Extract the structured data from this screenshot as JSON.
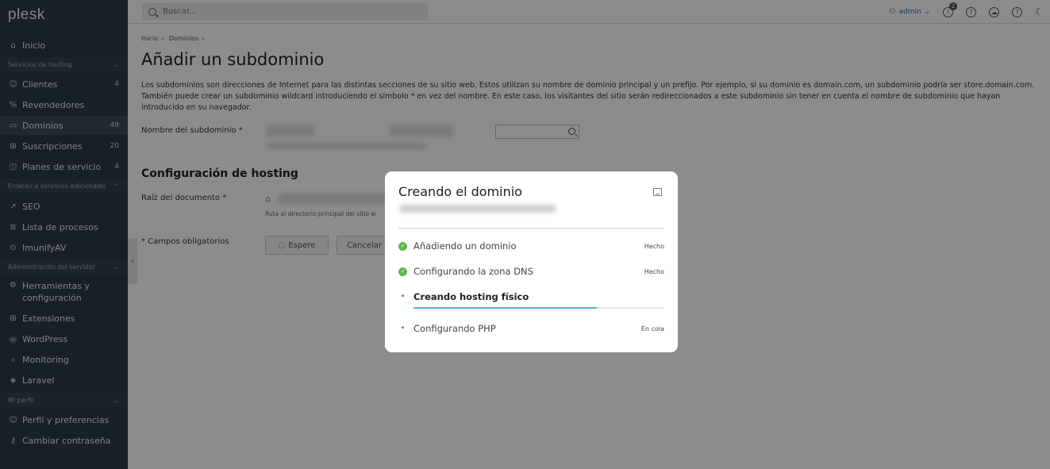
{
  "app": {
    "logo": "plesk"
  },
  "search": {
    "placeholder": "Buscar..."
  },
  "topbar": {
    "user": "admin",
    "notifications_count": "2"
  },
  "sidebar": {
    "items": [
      {
        "label": "Inicio",
        "icon": "home-icon"
      },
      {
        "label": "Clientes",
        "count": "4",
        "icon": "user-icon"
      },
      {
        "label": "Revendedores",
        "icon": "percent-icon"
      },
      {
        "label": "Dominios",
        "count": "49",
        "icon": "monitor-icon"
      },
      {
        "label": "Suscripciones",
        "count": "20",
        "icon": "grid-icon"
      },
      {
        "label": "Planes de servicio",
        "count": "4",
        "icon": "plan-icon"
      },
      {
        "label": "SEO",
        "icon": "seo-icon"
      },
      {
        "label": "Lista de procesos",
        "icon": "list-icon"
      },
      {
        "label": "ImunifyAV",
        "icon": "shield-icon"
      },
      {
        "label": "Herramientas y configuración",
        "icon": "tools-icon"
      },
      {
        "label": "Extensiones",
        "icon": "puzzle-icon"
      },
      {
        "label": "WordPress",
        "icon": "wordpress-icon"
      },
      {
        "label": "Monitoring",
        "icon": "monitoring-icon"
      },
      {
        "label": "Laravel",
        "icon": "laravel-icon"
      },
      {
        "label": "Perfil y preferencias",
        "icon": "profile-icon"
      },
      {
        "label": "Cambiar contraseña",
        "icon": "key-icon"
      }
    ],
    "sections": [
      {
        "label": "Servicios de hosting"
      },
      {
        "label": "Enlaces a servicios adicionales"
      },
      {
        "label": "Administración del servidor"
      },
      {
        "label": "Mi perfil"
      }
    ]
  },
  "main": {
    "breadcrumbs": [
      "Inicio",
      "Dominios"
    ],
    "title": "Añadir un subdominio",
    "description": "Los subdominios son direcciones de Internet para las distintas secciones de su sitio web. Estos utilizan su nombre de dominio principal y un prefijo. Por ejemplo, si su dominio es domain.com, un subdominio podría ser store.domain.com. También puede crear un subdominio wildcard introduciendo el símbolo * en vez del nombre. En este caso, los visitantes del sitio serán redireccionados a este subdominio sin tener en cuenta el nombre de subdominio que hayan introducido en su navegador.",
    "subdomain_label": "Nombre del subdominio *",
    "hosting_heading": "Configuración de hosting",
    "docroot_label": "Raíz del documento *",
    "docroot_hint": "Ruta al directorio principal del sitio w",
    "required_note": "* Campos obligatorios",
    "wait_button": "Espere",
    "cancel_button": "Cancelar"
  },
  "modal": {
    "title": "Creando el dominio",
    "steps": [
      {
        "label": "Añadiendo un dominio",
        "status": "Hecho"
      },
      {
        "label": "Configurando la zona DNS",
        "status": "Hecho"
      },
      {
        "label": "Creando hosting físico",
        "status": "",
        "progress": 0.73
      },
      {
        "label": "Configurando PHP",
        "status": "En cola"
      }
    ]
  },
  "colors": {
    "sidebar": "#2c3a47",
    "success": "#5cb848",
    "progress": "#57b5d2",
    "link": "#2a6fb0"
  }
}
